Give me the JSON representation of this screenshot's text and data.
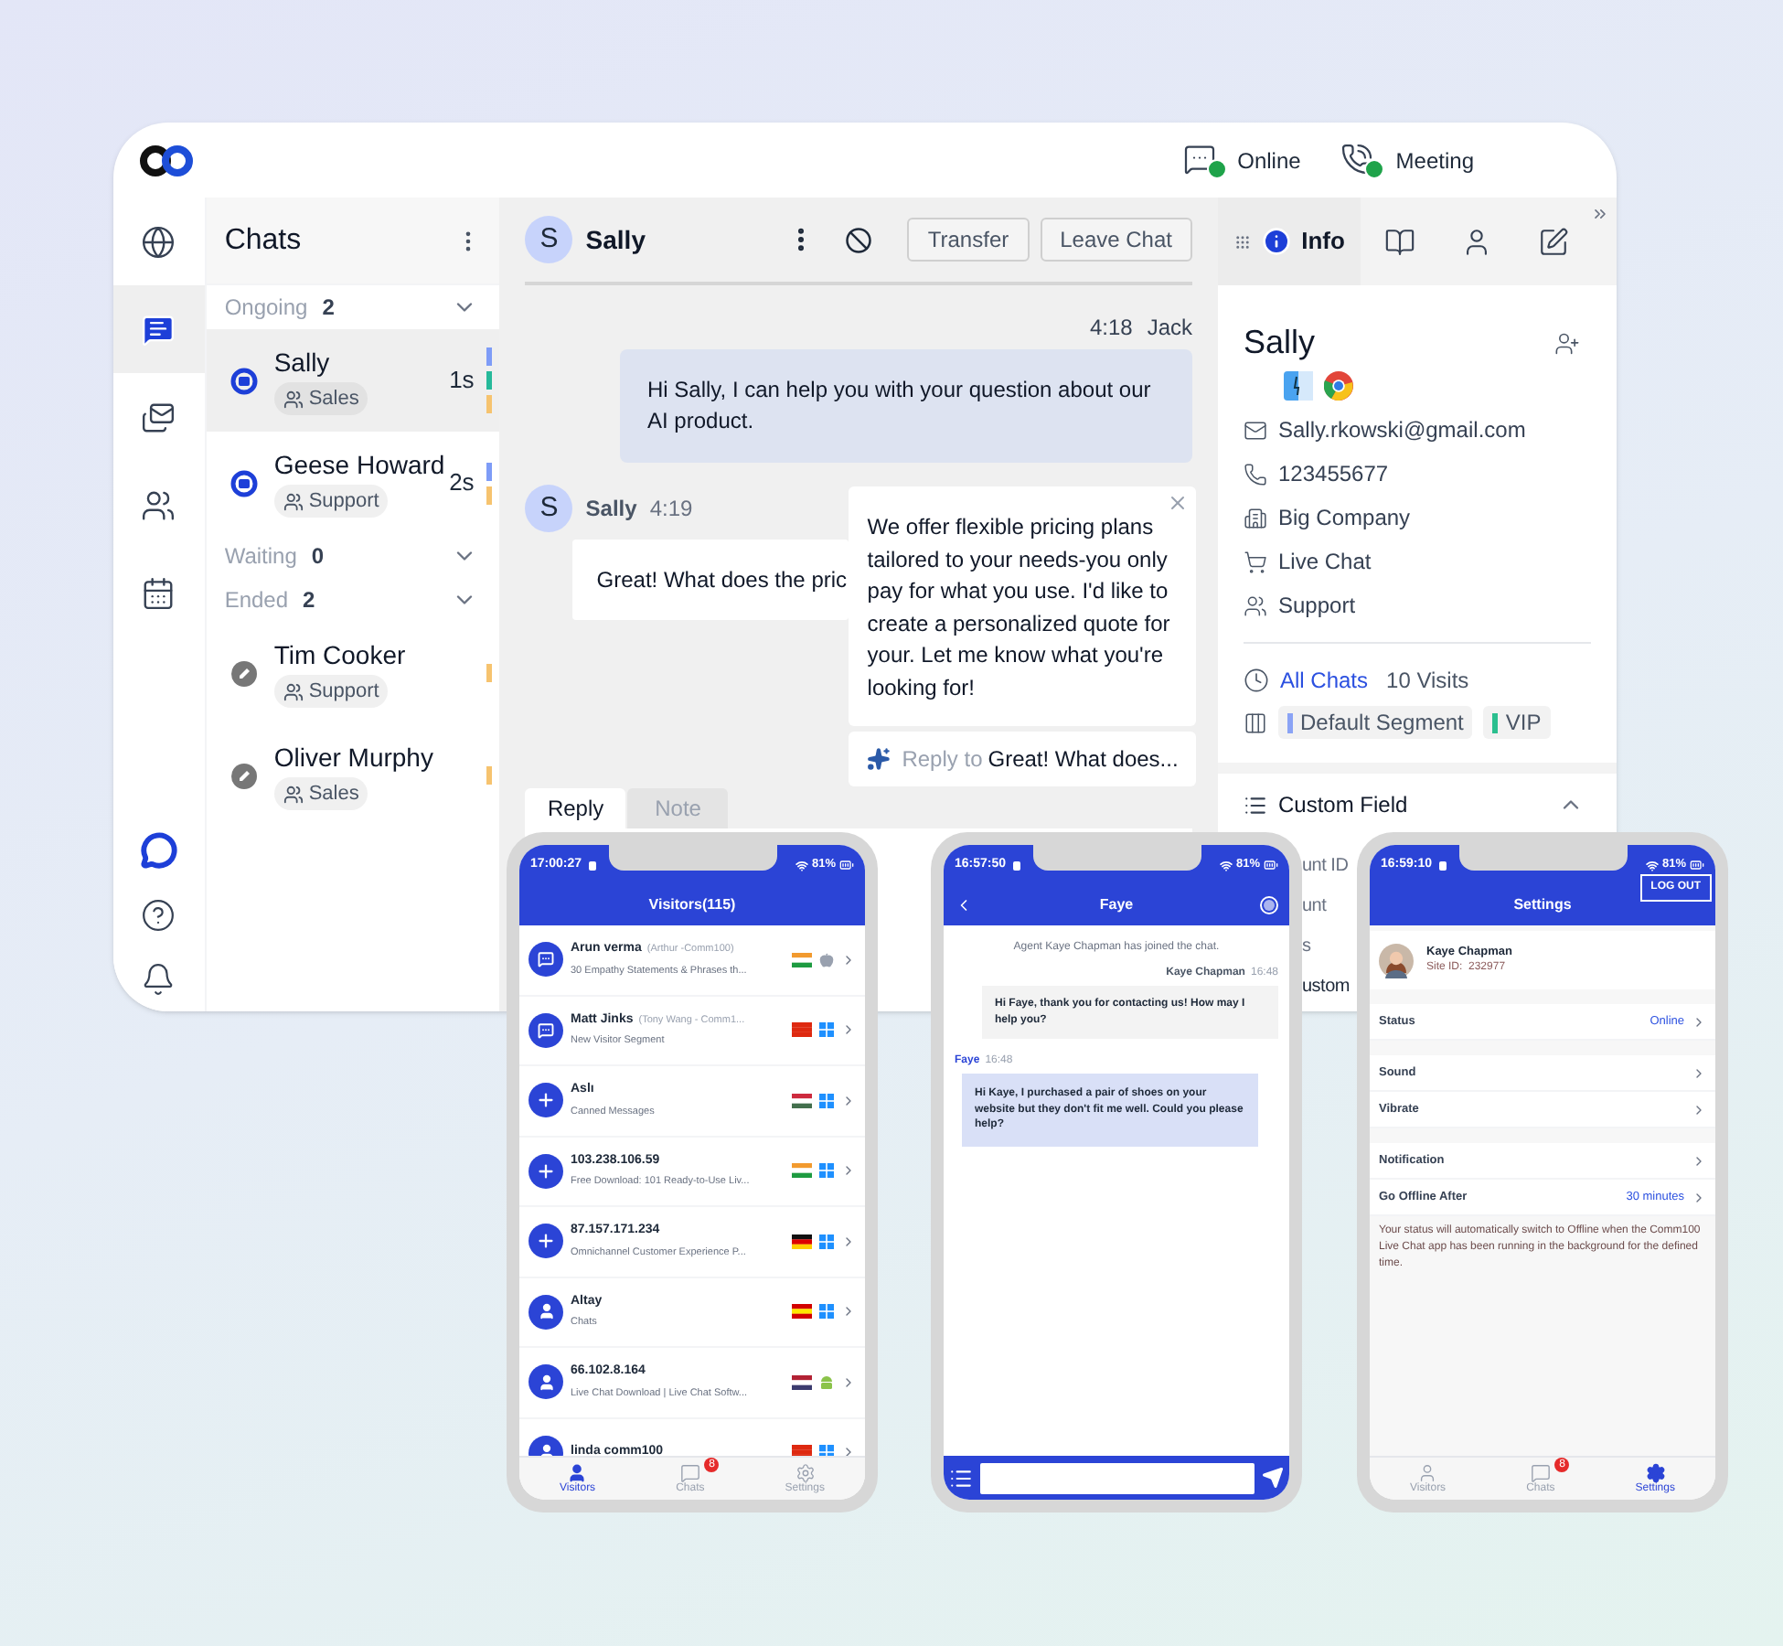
{
  "top_bar": {
    "statuses": [
      {
        "label": "Online",
        "kind": "chat"
      },
      {
        "label": "Meeting",
        "kind": "phone"
      }
    ]
  },
  "rail": {
    "items": [
      {
        "kind": "globe",
        "selected": false
      },
      {
        "kind": "chats",
        "selected": true
      },
      {
        "kind": "messages",
        "selected": false
      },
      {
        "kind": "team",
        "selected": false
      },
      {
        "kind": "calendar",
        "selected": false
      }
    ],
    "bottom": [
      {
        "kind": "brand"
      },
      {
        "kind": "help"
      },
      {
        "kind": "bell"
      }
    ]
  },
  "chat_list": {
    "title": "Chats",
    "groups": [
      {
        "label": "Ongoing",
        "count": "2",
        "chats": [
          {
            "name": "Sally",
            "tag": "Sales",
            "time": "1s",
            "kind": "active",
            "selected": true,
            "labels": [
              {
                "color": "#7e9cf7"
              },
              {
                "color": "#26b99a"
              },
              {
                "color": "#f6c36f"
              }
            ]
          },
          {
            "name": "Geese Howard",
            "tag": "Support",
            "time": "2s",
            "kind": "active",
            "selected": false,
            "labels": [
              {
                "color": "#7e9cf7"
              },
              {
                "color": "#f6c36f"
              }
            ]
          }
        ]
      },
      {
        "label": "Waiting",
        "count": "0"
      },
      {
        "label": "Ended",
        "count": "2",
        "chats": [
          {
            "name": "Tim Cooker",
            "tag": "Support",
            "kind": "ended",
            "selected": false,
            "labels": [
              {
                "color": "#f6c36f"
              }
            ]
          },
          {
            "name": "Oliver Murphy",
            "tag": "Sales",
            "kind": "ended",
            "selected": false,
            "labels": [
              {
                "color": "#f6c36f"
              }
            ]
          }
        ]
      }
    ]
  },
  "conversation": {
    "contact": {
      "initial": "S",
      "name": "Sally"
    },
    "buttons": [
      "Transfer",
      "Leave Chat"
    ],
    "messages": [
      {
        "kind": "agent",
        "time": "4:18",
        "author": "Jack",
        "text": "Hi Sally, I can help you with your question about our AI product."
      },
      {
        "kind": "visitor",
        "initial": "S",
        "author": "Sally",
        "time": "4:19",
        "text": "Great! What does the pric"
      }
    ],
    "suggestion": {
      "text": "We offer flexible pricing plans tailored to your needs-you only pay for what  you use. I'd like to create a personalized quote for your. Let me know what you're looking for!",
      "reply_label": "Reply to",
      "reply_text": "Great! What does..."
    },
    "composer_tabs": [
      {
        "label": "Reply",
        "selected": true
      },
      {
        "label": "Note",
        "selected": false
      }
    ]
  },
  "info_panel": {
    "tabs": [
      {
        "kind": "info",
        "label": "Info",
        "selected": true
      },
      {
        "kind": "book",
        "selected": false
      },
      {
        "kind": "person",
        "selected": false
      },
      {
        "kind": "edit",
        "selected": false
      }
    ],
    "name": "Sally",
    "details": [
      {
        "kind": "email",
        "text": "Sally.rkowski@gmail.com"
      },
      {
        "kind": "phone",
        "text": "123455677"
      },
      {
        "kind": "company",
        "text": "Big Company"
      },
      {
        "kind": "cart",
        "text": "Live Chat"
      },
      {
        "kind": "team",
        "text": "Support"
      }
    ],
    "all_chats": "All Chats",
    "visits": "10 Visits",
    "segments": [
      {
        "label": "Default Segment",
        "color": "#8aa3f5"
      },
      {
        "label": "VIP",
        "color": "#2bbf8f"
      }
    ],
    "custom_field": {
      "title": "Custom Field",
      "expanded": true,
      "rows": [
        "unt ID",
        "unt",
        "s",
        "ustom"
      ]
    }
  },
  "visitors_phone": {
    "time": "17:00:27",
    "battery": "81%",
    "title": "Visitors(115)",
    "visitors": [
      {
        "kind": "chatting",
        "name": "Arun verma",
        "agent": "(Arthur -Comm100)",
        "subtitle": "30 Empathy Statements & Phrases th...",
        "flag": {
          "kind": "in"
        },
        "os": {
          "kind": "apple"
        }
      },
      {
        "kind": "chatting",
        "name": "Matt Jinks",
        "agent": "(Tony Wang - Comm1...",
        "subtitle": "New Visitor Segment",
        "flag": {
          "kind": "cn"
        },
        "os": {
          "kind": "windows"
        }
      },
      {
        "kind": "invite",
        "name": "Aslı",
        "subtitle": "Canned Messages",
        "flag": {
          "kind": "hu"
        },
        "os": {
          "kind": "windows"
        }
      },
      {
        "kind": "invite",
        "name": "103.238.106.59",
        "subtitle": "Free Download: 101 Ready-to-Use Liv...",
        "flag": {
          "kind": "in"
        },
        "os": {
          "kind": "windows"
        }
      },
      {
        "kind": "invite",
        "name": "87.157.171.234",
        "subtitle": "Omnichannel Customer Experience P...",
        "flag": {
          "kind": "de"
        },
        "os": {
          "kind": "windows"
        }
      },
      {
        "kind": "browsing",
        "name": "Altay",
        "subtitle": "Chats",
        "flag": {
          "kind": "mk"
        },
        "os": {
          "kind": "windows"
        }
      },
      {
        "kind": "browsing",
        "name": "66.102.8.164",
        "subtitle": "Live Chat Download | Live Chat Softw...",
        "flag": {
          "kind": "us"
        },
        "os": {
          "kind": "android"
        }
      },
      {
        "kind": "browsing",
        "name": "linda comm100",
        "flag": {
          "kind": "cn"
        },
        "os": {
          "kind": "windows"
        }
      }
    ],
    "tabs": [
      {
        "kind": "visitors",
        "label": "Visitors",
        "selected": true
      },
      {
        "kind": "chats",
        "label": "Chats",
        "badge": "8",
        "selected": false
      },
      {
        "kind": "settings",
        "label": "Settings",
        "selected": false
      }
    ]
  },
  "chat_phone": {
    "time": "16:57:50",
    "battery": "81%",
    "title": "Faye",
    "system_note": "Agent Kaye Chapman has joined the chat.",
    "messages": [
      {
        "kind": "agent",
        "author": "Kaye Chapman",
        "time": "16:48",
        "text": "Hi Faye, thank you for contacting us! How may I help you?"
      },
      {
        "kind": "visitor",
        "author": "Faye",
        "time": "16:48",
        "text": "Hi Kaye, I purchased a pair of shoes on your website but they don't fit me well. Could you please help?"
      }
    ]
  },
  "settings_phone": {
    "time": "16:59:10",
    "battery": "81%",
    "title": "Settings",
    "logout": "LOG OUT",
    "agent": "Kaye Chapman",
    "site_id": "Site ID:  232977",
    "groups": [
      [
        {
          "label": "Status",
          "value": "Online"
        }
      ],
      [
        {
          "label": "Sound"
        },
        {
          "label": "Vibrate"
        }
      ],
      [
        {
          "label": "Notification"
        },
        {
          "label": "Go Offline After",
          "value": "30 minutes"
        }
      ]
    ],
    "note": "Your status will automatically switch to Offline when the Comm100 Live Chat app has been running in the background for the defined time.",
    "tabs": [
      {
        "kind": "visitors",
        "label": "Visitors",
        "selected": false
      },
      {
        "kind": "chats",
        "label": "Chats",
        "badge": "8",
        "selected": false
      },
      {
        "kind": "settings",
        "label": "Settings",
        "selected": true
      }
    ]
  }
}
